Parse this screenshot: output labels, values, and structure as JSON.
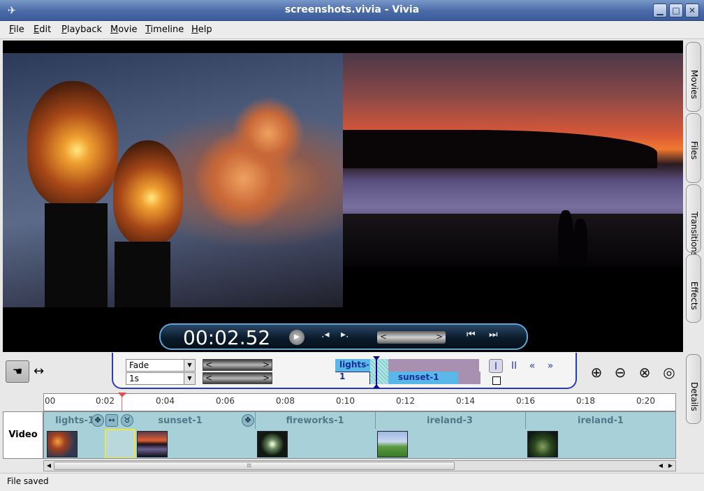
{
  "window": {
    "title": "screenshots.vivia - Vivia"
  },
  "menu": [
    "File",
    "Edit",
    "Playback",
    "Movie",
    "Timeline",
    "Help"
  ],
  "player": {
    "timecode": "00:02.52"
  },
  "side_tabs": [
    "Movies",
    "Files",
    "Transitions",
    "Effects",
    "Details"
  ],
  "transition": {
    "type": "Fade",
    "duration": "1s",
    "clip_a": "lights-1",
    "clip_b": "sunset-1"
  },
  "timeline": {
    "ticks": [
      "00",
      "0:02",
      "0:04",
      "0:06",
      "0:08",
      "0:10",
      "0:12",
      "0:14",
      "0:16",
      "0:18",
      "0:20"
    ],
    "track_name": "Video",
    "clips": [
      "lights-1",
      "sunset-1",
      "fireworks-1",
      "ireland-3",
      "ireland-1"
    ]
  },
  "status": {
    "message": "File saved"
  },
  "icons": {
    "app": "app-icon",
    "hand": "hand-icon",
    "zoom_in": "zoom-in-icon",
    "zoom_out": "zoom-out-icon",
    "zoom_fit": "zoom-fit-icon",
    "zoom_select": "zoom-select-icon"
  },
  "colors": {
    "titlebar": "#4a6aa8",
    "accent": "#2a3ab8",
    "track": "#a8d0d8",
    "clip": "#5ab8e8"
  }
}
